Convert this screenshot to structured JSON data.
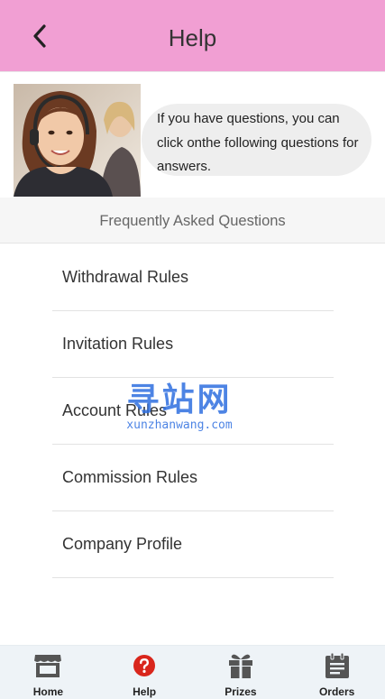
{
  "header": {
    "title": "Help",
    "back_icon": "chevron-left-icon",
    "background": "#f19fd3"
  },
  "intro": {
    "message": "If you have questions, you can click onthe following questions for answers."
  },
  "faq": {
    "heading": "Frequently Asked Questions",
    "items": [
      "Withdrawal Rules",
      "Invitation Rules",
      "Account Rules",
      "Commission Rules",
      "Company Profile"
    ]
  },
  "watermark": {
    "cn": "寻站网",
    "en": "xunzhanwang.com"
  },
  "tabbar": {
    "items": [
      {
        "label": "Home",
        "icon": "store-icon"
      },
      {
        "label": "Help",
        "icon": "question-icon",
        "active": true,
        "accent": "#d9261c"
      },
      {
        "label": "Prizes",
        "icon": "gift-icon"
      },
      {
        "label": "Orders",
        "icon": "clipboard-icon"
      }
    ]
  }
}
